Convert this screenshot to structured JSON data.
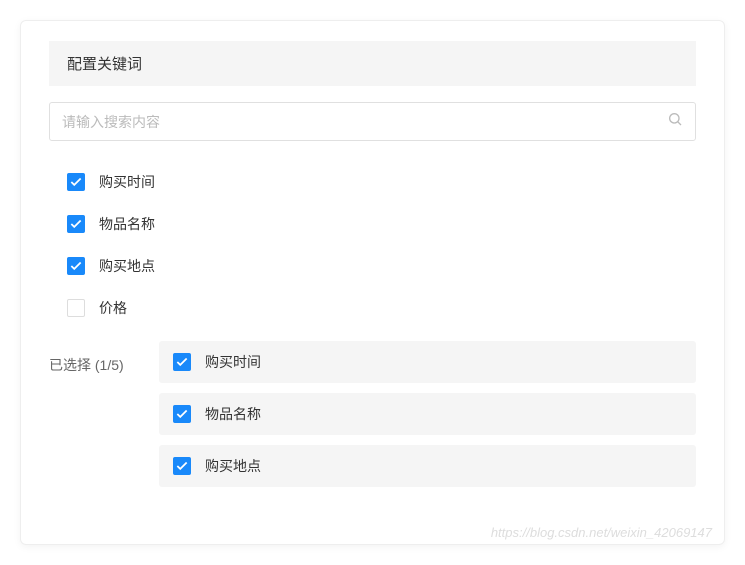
{
  "header": {
    "title": "配置关键词"
  },
  "search": {
    "placeholder": "请输入搜索内容"
  },
  "options": [
    {
      "label": "购买时间",
      "checked": true
    },
    {
      "label": "物品名称",
      "checked": true
    },
    {
      "label": "购买地点",
      "checked": true
    },
    {
      "label": "价格",
      "checked": false
    }
  ],
  "selected": {
    "label_prefix": "已选择",
    "count_display": "(1/5)",
    "items": [
      {
        "label": "购买时间",
        "checked": true
      },
      {
        "label": "物品名称",
        "checked": true
      },
      {
        "label": "购买地点",
        "checked": true
      }
    ]
  },
  "watermark": "https://blog.csdn.net/weixin_42069147"
}
